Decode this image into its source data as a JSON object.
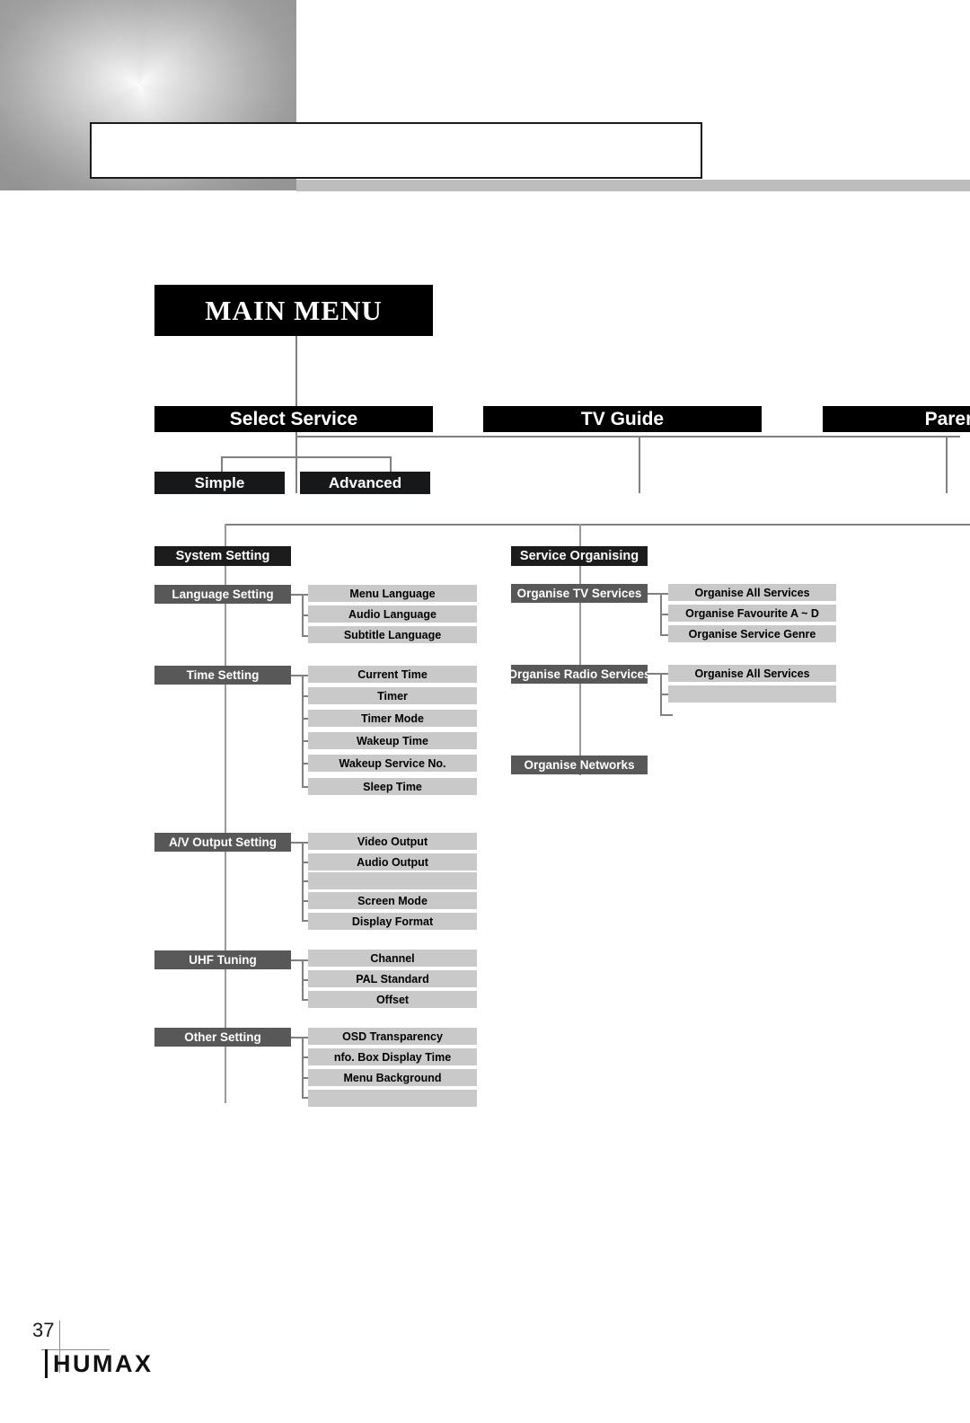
{
  "header": {
    "title": "",
    "decor_icon": "gradient-block"
  },
  "footer": {
    "page_number": "37",
    "brand": "HUMAX"
  },
  "diagram": {
    "type": "tree-menu-map",
    "root": {
      "label": "MAIN  MENU"
    },
    "level1": [
      {
        "label": "Select Service"
      },
      {
        "label": "TV Guide"
      },
      {
        "label": "Parental"
      }
    ],
    "level2": [
      {
        "label": "Simple"
      },
      {
        "label": "Advanced"
      }
    ],
    "sections": [
      {
        "label": "System Setting",
        "groups": [
          {
            "label": "Language Setting",
            "items": [
              "Menu Language",
              "Audio Language",
              "Subtitle Language"
            ]
          },
          {
            "label": "Time Setting",
            "items": [
              "Current Time",
              "Timer",
              "Timer Mode",
              "Wakeup Time",
              "Wakeup Service No.",
              "Sleep Time"
            ]
          },
          {
            "label": "A/V Output Setting",
            "items": [
              "Video  Output",
              "Audio Output",
              "",
              "Screen Mode",
              "Display Format"
            ]
          },
          {
            "label": "UHF Tuning",
            "items": [
              "Channel",
              "PAL Standard",
              "Offset"
            ]
          },
          {
            "label": "Other Setting",
            "items": [
              "OSD Transparency",
              "nfo. Box Display Time",
              "Menu Background",
              ""
            ]
          }
        ]
      },
      {
        "label": "Service Organising",
        "groups": [
          {
            "label": "Organise TV Services",
            "items": [
              "Organise All Services",
              "Organise Favourite A ~ D",
              "Organise  Service Genre"
            ]
          },
          {
            "label": "Organise Radio Services",
            "items": [
              "Organise All Services",
              ""
            ]
          },
          {
            "label": "Organise Networks",
            "items": []
          }
        ]
      }
    ]
  },
  "colors": {
    "root_bg": "#000000",
    "section_bg": "#1c1c1c",
    "group_bg": "#585858",
    "leaf_bg": "#c9c9c9",
    "connector": "#808080",
    "header_rule": "#bdbdbd"
  }
}
